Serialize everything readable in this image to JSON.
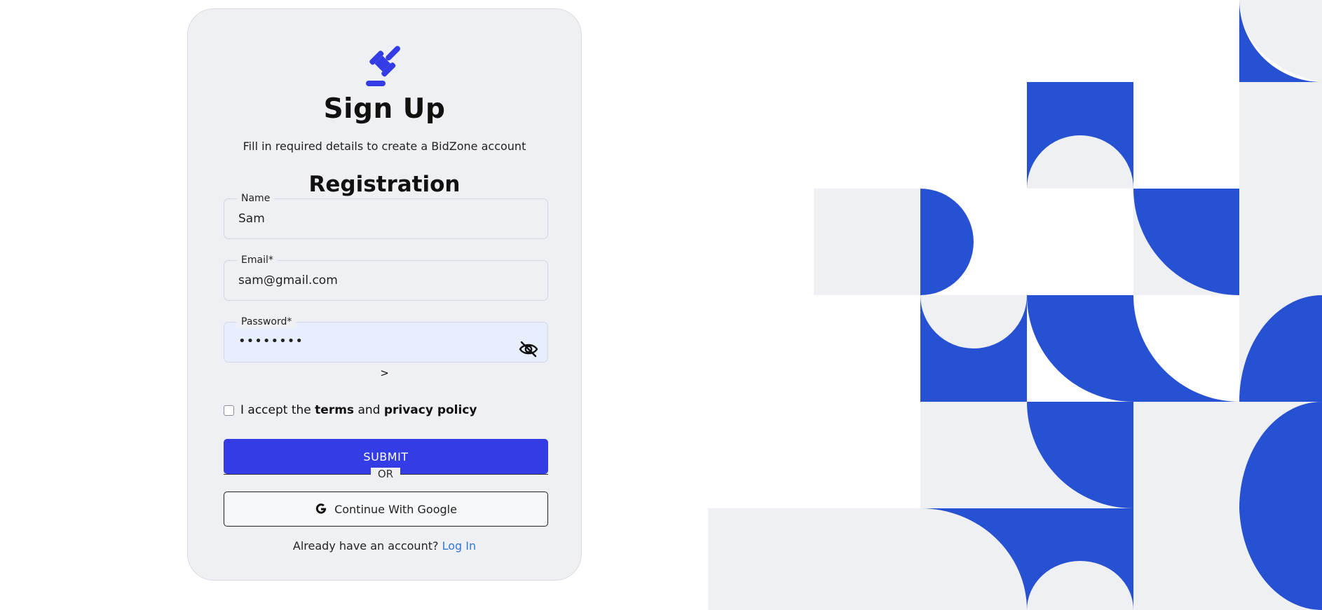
{
  "header": {
    "title": "Sign Up",
    "subtitle": "Fill in required details to create a BidZone account",
    "section_title": "Registration",
    "logo_icon": "gavel-icon"
  },
  "form": {
    "name": {
      "label": "Name",
      "value": "Sam"
    },
    "email": {
      "label": "Email*",
      "value": "sam@gmail.com"
    },
    "password": {
      "label": "Password*",
      "value": "••••••••",
      "toggle_icon": "eye-off-icon"
    },
    "arrow_text": ">",
    "terms": {
      "prefix": "I accept the",
      "terms_link": "terms",
      "middle": "and",
      "privacy_link": "privacy policy",
      "checked": false
    },
    "submit_label": "SUBMIT",
    "or_text": "OR",
    "google_label": "Continue With Google",
    "login_prompt": "Already have an account?",
    "login_link": "Log In"
  },
  "colors": {
    "accent": "#343de5",
    "pattern_blue": "#2751d3",
    "pattern_grey": "#eff0f4",
    "card_bg": "#eff0f4",
    "link": "#2f78d6"
  }
}
